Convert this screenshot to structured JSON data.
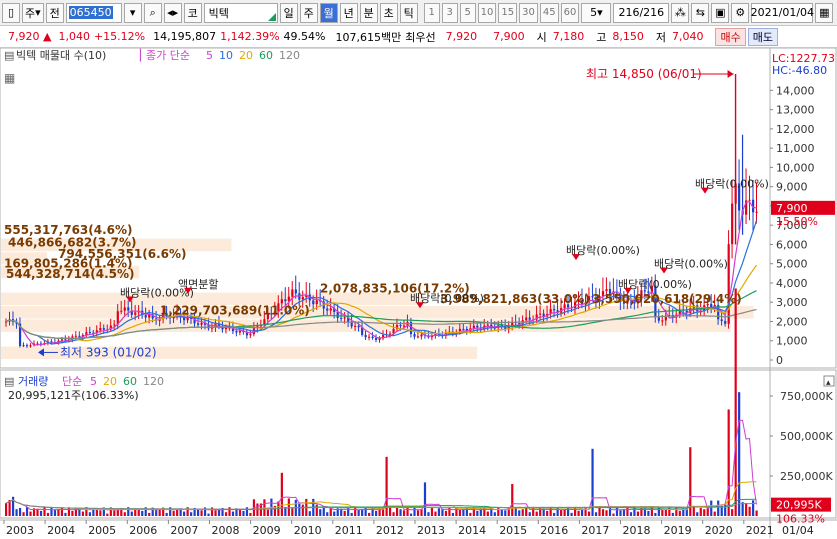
{
  "toolbar": {
    "market": "주",
    "side": "전",
    "code": "065450",
    "icon_button": "코",
    "stock_name": "빅텍",
    "periods": [
      "일",
      "주",
      "월",
      "년",
      "분",
      "초",
      "틱"
    ],
    "active_period": "월",
    "interval_numbers": [
      "1",
      "3",
      "5",
      "10",
      "15",
      "30",
      "45",
      "60"
    ],
    "interval_select": "5",
    "count": "216/216",
    "date": "2021/01/04"
  },
  "quote": {
    "price": "7,920",
    "change": "1,040",
    "change_pct": "+15.12%",
    "volume": "14,195,807",
    "volume_pct": "1,142.39%",
    "turnover": "49.54%",
    "trade_value": "107,615백만",
    "priority_ask_label": "최우선",
    "ask": "7,920",
    "bid": "7,900",
    "open_label": "시",
    "open": "7,180",
    "high_label": "고",
    "high": "8,150",
    "low_label": "저",
    "low": "7,040",
    "buy_label": "매수",
    "sell_label": "매도"
  },
  "price_pane": {
    "title": "빅텍 매물대 수(10)",
    "ma_label": "종가 단순",
    "ma_periods": [
      "5",
      "10",
      "20",
      "60",
      "120"
    ],
    "ma_colors": [
      "#d03fd0",
      "#2a6fe0",
      "#e0a800",
      "#1a9e5c",
      "#888888"
    ],
    "lc": "LC:1227.73",
    "hc": "HC:-46.80",
    "y_ticks": [
      "14,000",
      "13,000",
      "12,000",
      "11,000",
      "10,000",
      "9,000",
      "8,000",
      "7,000",
      "6,000",
      "5,000",
      "4,000",
      "3,000",
      "2,000",
      "1,000",
      "0"
    ],
    "current_price": "7,900",
    "current_pct": "15.50%",
    "max_annotation": "최고 14,850 (06/01)",
    "min_annotation": "최저 393 (01/02)",
    "volume_profile": [
      "555,317,763(4.6%)",
      "446,866,682(3.7%)",
      "794,556,351(6.6%)",
      "169,805,286(1.4%)",
      "544,328,714(4.5%)",
      "2,078,835,106(17.2%)",
      "3,989,821,863(33.0%)",
      "3,550,020,618(29.4%)",
      "1,229,703,689(11.0%)"
    ],
    "events": [
      "배당락(0.00%)",
      "액면분할",
      "배당락(0.00%)",
      "배당락(0.00%)",
      "배당락(0.00%)",
      "배당락(0.00%)",
      "배당락(0.00%)"
    ]
  },
  "volume_pane": {
    "title": "거래량",
    "ma_label": "단순",
    "ma_periods": [
      "5",
      "20",
      "60",
      "120"
    ],
    "ma_colors": [
      "#d03fd0",
      "#e0a800",
      "#1a9e5c",
      "#888888"
    ],
    "info": "20,995,121주(106.33%)",
    "y_ticks": [
      "750,000K",
      "500,000K",
      "250,000K"
    ],
    "current_value": "20,995K",
    "current_pct": "106.33%"
  },
  "x_axis": [
    "2003",
    "2004",
    "2005",
    "2006",
    "2007",
    "2008",
    "2009",
    "2010",
    "2011",
    "2012",
    "2013",
    "2014",
    "2015",
    "2016",
    "2017",
    "2018",
    "2019",
    "2020",
    "2021",
    "01/04"
  ]
}
